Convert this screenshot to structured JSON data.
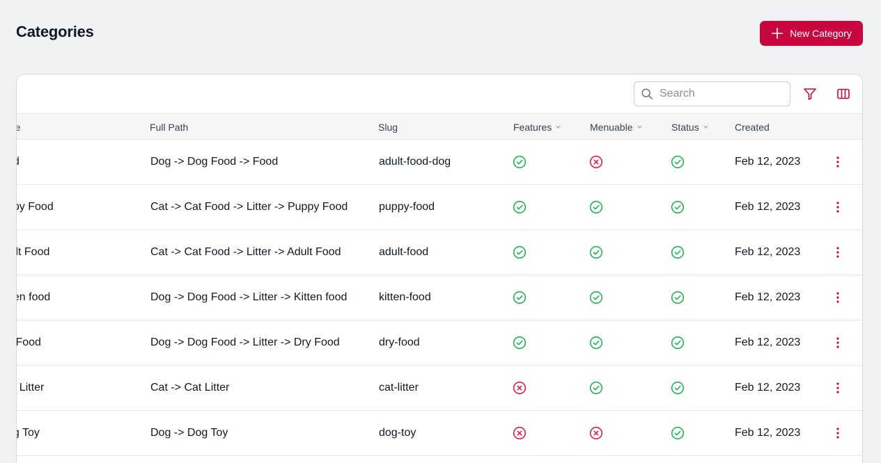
{
  "header": {
    "title": "Categories",
    "new_button_label": "New Category"
  },
  "toolbar": {
    "search_placeholder": "Search"
  },
  "colors": {
    "accent": "#c8073f",
    "check": "#22b356",
    "cross": "#e11d48"
  },
  "columns": {
    "name": "me",
    "full_path": "Full Path",
    "slug": "Slug",
    "features": "Features",
    "menuable": "Menuable",
    "status": "Status",
    "created": "Created"
  },
  "rows": [
    {
      "name": "od",
      "full_path": "Dog -> Dog Food -> Food",
      "slug": "adult-food-dog",
      "features": true,
      "menuable": false,
      "status": true,
      "created": "Feb 12, 2023"
    },
    {
      "name": "ppy Food",
      "full_path": "Cat -> Cat Food -> Litter -> Puppy Food",
      "slug": "puppy-food",
      "features": true,
      "menuable": true,
      "status": true,
      "created": "Feb 12, 2023"
    },
    {
      "name": "lult Food",
      "full_path": "Cat -> Cat Food -> Litter -> Adult Food",
      "slug": "adult-food",
      "features": true,
      "menuable": true,
      "status": true,
      "created": "Feb 12, 2023"
    },
    {
      "name": "tten food",
      "full_path": "Dog -> Dog Food -> Litter -> Kitten food",
      "slug": "kitten-food",
      "features": true,
      "menuable": true,
      "status": true,
      "created": "Feb 12, 2023"
    },
    {
      "name": "y Food",
      "full_path": "Dog -> Dog Food -> Litter -> Dry Food",
      "slug": "dry-food",
      "features": true,
      "menuable": true,
      "status": true,
      "created": "Feb 12, 2023"
    },
    {
      "name": "at Litter",
      "full_path": "Cat -> Cat Litter",
      "slug": "cat-litter",
      "features": false,
      "menuable": true,
      "status": true,
      "created": "Feb 12, 2023"
    },
    {
      "name": "og Toy",
      "full_path": "Dog -> Dog Toy",
      "slug": "dog-toy",
      "features": false,
      "menuable": false,
      "status": true,
      "created": "Feb 12, 2023"
    }
  ]
}
